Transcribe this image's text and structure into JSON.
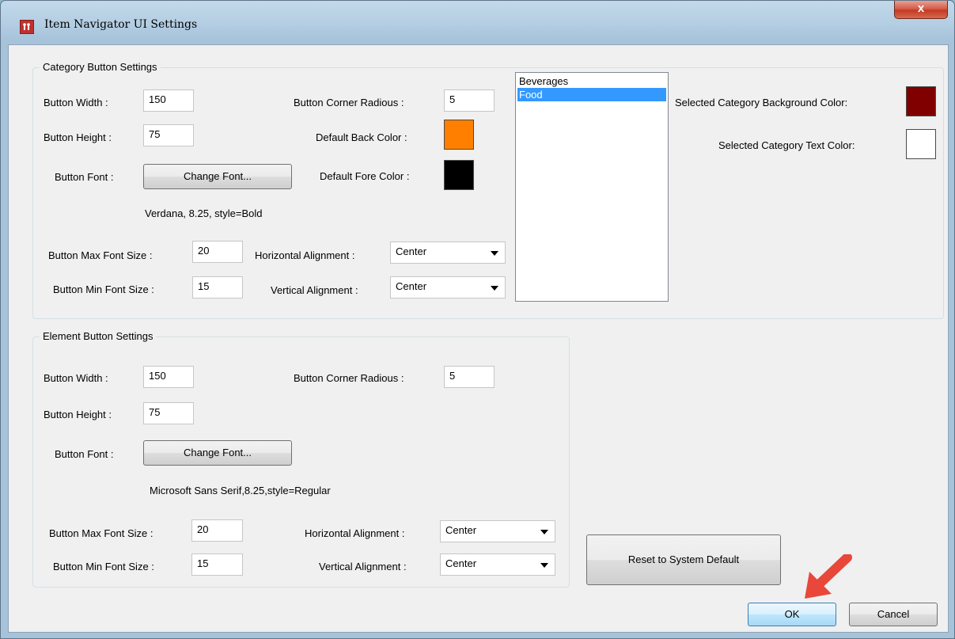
{
  "window": {
    "title": "Item Navigator UI Settings",
    "close_glyph": "x"
  },
  "category": {
    "group_title": "Category Button Settings",
    "width_label": "Button Width :",
    "width_value": "150",
    "height_label": "Button Height :",
    "height_value": "75",
    "font_label": "Button Font :",
    "change_font_label": "Change Font...",
    "font_desc": "Verdana, 8.25, style=Bold",
    "max_font_label": "Button Max Font Size :",
    "max_font_value": "20",
    "min_font_label": "Button Min Font Size :",
    "min_font_value": "15",
    "corner_label": "Button Corner Radious :",
    "corner_value": "5",
    "back_color_label": "Default Back Color :",
    "back_color": "#ff8000",
    "fore_color_label": "Default Fore Color :",
    "fore_color": "#000000",
    "h_align_label": "Horizontal Alignment :",
    "h_align_value": "Center",
    "v_align_label": "Vertical Alignment :",
    "v_align_value": "Center",
    "list_items": [
      "Beverages",
      "Food"
    ],
    "selected_item": "Food",
    "sel_bg_label": "Selected Category Background Color:",
    "sel_bg_color": "#800000",
    "sel_text_label": "Selected Category Text Color:",
    "sel_text_color": "#ffffff"
  },
  "element": {
    "group_title": "Element Button Settings",
    "width_label": "Button Width :",
    "width_value": "150",
    "height_label": "Button Height :",
    "height_value": "75",
    "font_label": "Button Font :",
    "change_font_label": "Change Font...",
    "font_desc": "Microsoft Sans Serif,8.25,style=Regular",
    "max_font_label": "Button Max Font Size :",
    "max_font_value": "20",
    "min_font_label": "Button Min Font Size :",
    "min_font_value": "15",
    "corner_label": "Button Corner Radious :",
    "corner_value": "5",
    "h_align_label": "Horizontal Alignment :",
    "h_align_value": "Center",
    "v_align_label": "Vertical Alignment :",
    "v_align_value": "Center"
  },
  "actions": {
    "reset_label": "Reset to System Default",
    "ok_label": "OK",
    "cancel_label": "Cancel"
  },
  "colors": {
    "accent": "#3399ff",
    "pointer_arrow": "#e8473a"
  }
}
